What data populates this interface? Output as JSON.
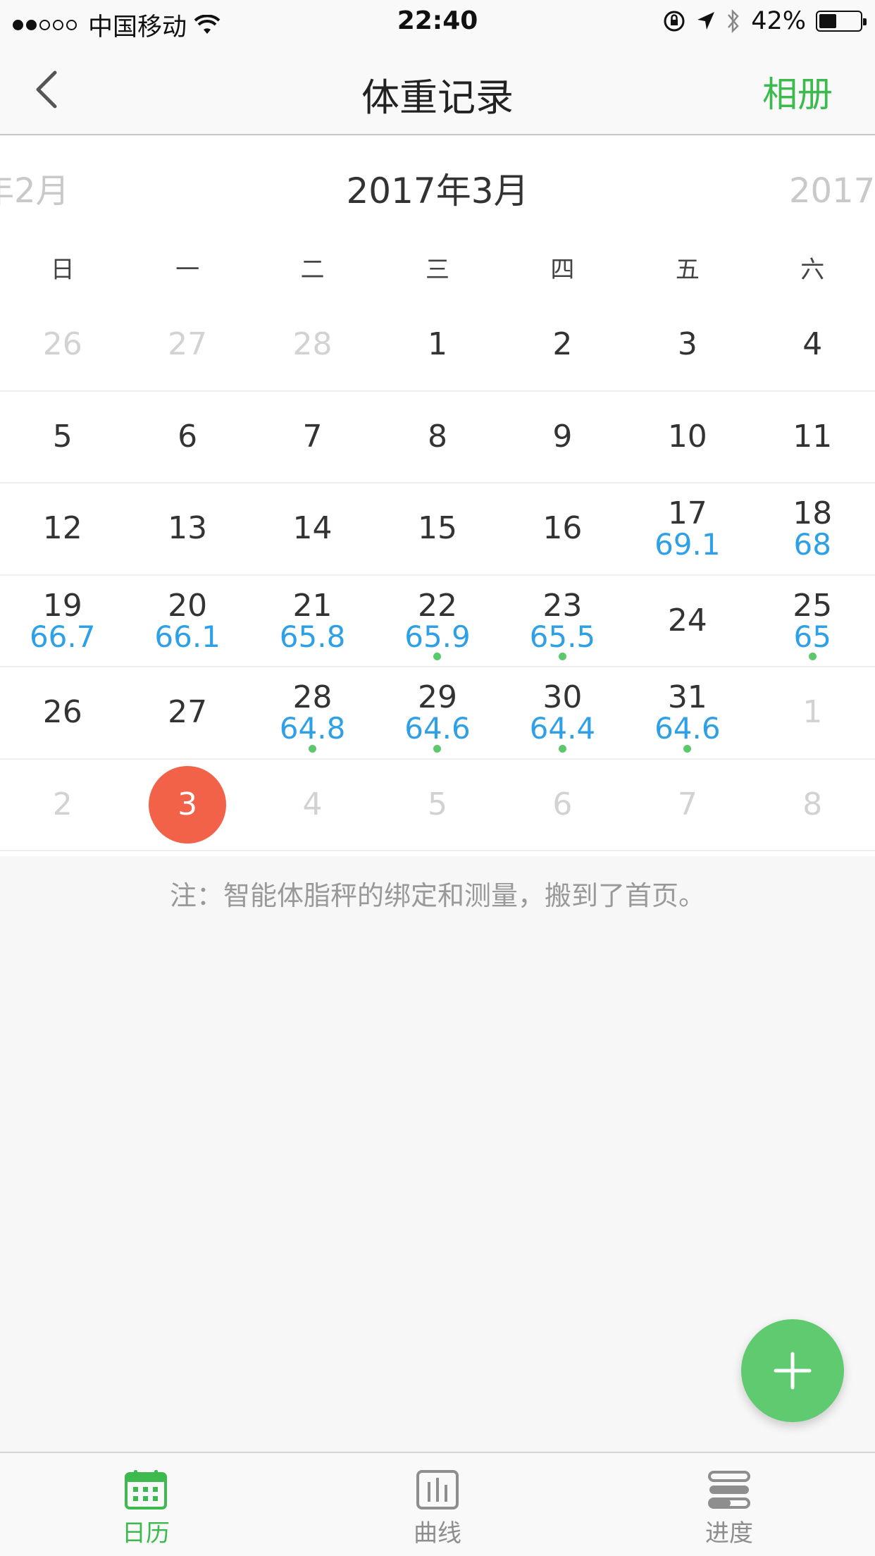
{
  "status_bar": {
    "carrier": "中国移动",
    "time": "22:40",
    "battery": "42%",
    "battery_level": 0.42,
    "signal_bars": 2,
    "icons": [
      "wifi-icon",
      "orientation-lock-icon",
      "location-arrow-icon",
      "bluetooth-icon",
      "battery-icon"
    ]
  },
  "nav": {
    "title": "体重记录",
    "right_action": "相册",
    "back_icon": "chevron-left-icon"
  },
  "calendar": {
    "prev_month": "年2月",
    "current_month": "2017年3月",
    "next_month": "2017年",
    "weekdays": [
      "日",
      "一",
      "二",
      "三",
      "四",
      "五",
      "六"
    ],
    "weeks": [
      [
        {
          "day": "26",
          "faded": true
        },
        {
          "day": "27",
          "faded": true
        },
        {
          "day": "28",
          "faded": true
        },
        {
          "day": "1"
        },
        {
          "day": "2"
        },
        {
          "day": "3"
        },
        {
          "day": "4"
        }
      ],
      [
        {
          "day": "5"
        },
        {
          "day": "6"
        },
        {
          "day": "7"
        },
        {
          "day": "8"
        },
        {
          "day": "9"
        },
        {
          "day": "10"
        },
        {
          "day": "11"
        }
      ],
      [
        {
          "day": "12"
        },
        {
          "day": "13"
        },
        {
          "day": "14"
        },
        {
          "day": "15"
        },
        {
          "day": "16"
        },
        {
          "day": "17",
          "weight": "69.1"
        },
        {
          "day": "18",
          "weight": "68"
        }
      ],
      [
        {
          "day": "19",
          "weight": "66.7"
        },
        {
          "day": "20",
          "weight": "66.1"
        },
        {
          "day": "21",
          "weight": "65.8"
        },
        {
          "day": "22",
          "weight": "65.9",
          "dot": true
        },
        {
          "day": "23",
          "weight": "65.5",
          "dot": true
        },
        {
          "day": "24"
        },
        {
          "day": "25",
          "weight": "65",
          "dot": true
        }
      ],
      [
        {
          "day": "26"
        },
        {
          "day": "27"
        },
        {
          "day": "28",
          "weight": "64.8",
          "dot": true
        },
        {
          "day": "29",
          "weight": "64.6",
          "dot": true
        },
        {
          "day": "30",
          "weight": "64.4",
          "dot": true
        },
        {
          "day": "31",
          "weight": "64.6",
          "dot": true
        },
        {
          "day": "1",
          "faded": true
        }
      ],
      [
        {
          "day": "2",
          "faded": true
        },
        {
          "day": "3",
          "today": true
        },
        {
          "day": "4",
          "faded": true
        },
        {
          "day": "5",
          "faded": true
        },
        {
          "day": "6",
          "faded": true
        },
        {
          "day": "7",
          "faded": true
        },
        {
          "day": "8",
          "faded": true
        }
      ]
    ]
  },
  "note": "注：智能体脂秤的绑定和测量，搬到了首页。",
  "fab": {
    "icon": "plus-icon"
  },
  "tabs": [
    {
      "label": "日历",
      "icon": "calendar-icon",
      "active": true
    },
    {
      "label": "曲线",
      "icon": "bar-chart-icon",
      "active": false
    },
    {
      "label": "进度",
      "icon": "progress-icon",
      "active": false
    }
  ],
  "colors": {
    "accent_green": "#3dba4e",
    "weight_blue": "#2ea0e8",
    "today_red": "#f26248",
    "dot_green": "#5cc86c"
  }
}
